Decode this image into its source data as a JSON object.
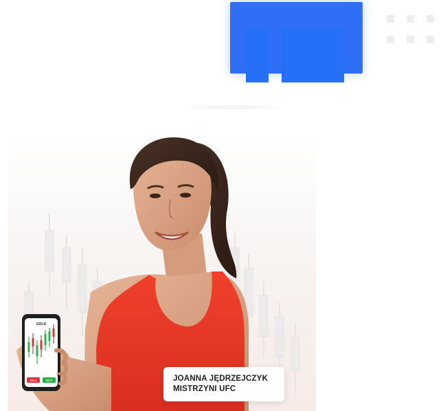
{
  "decor": {
    "accent_color": "#2670f7",
    "dot_color": "#eeeeee"
  },
  "hero": {
    "image_icon": "athlete-portrait",
    "phone": {
      "pair_label": "GOLD",
      "sell_label": "SELL",
      "buy_label": "BUY",
      "sell_color": "#e0333a",
      "buy_color": "#2bb34a"
    },
    "caption": {
      "line1": "JOANNA JĘDRZEJCZYK",
      "line2": "MISTRZYNI UFC"
    }
  }
}
